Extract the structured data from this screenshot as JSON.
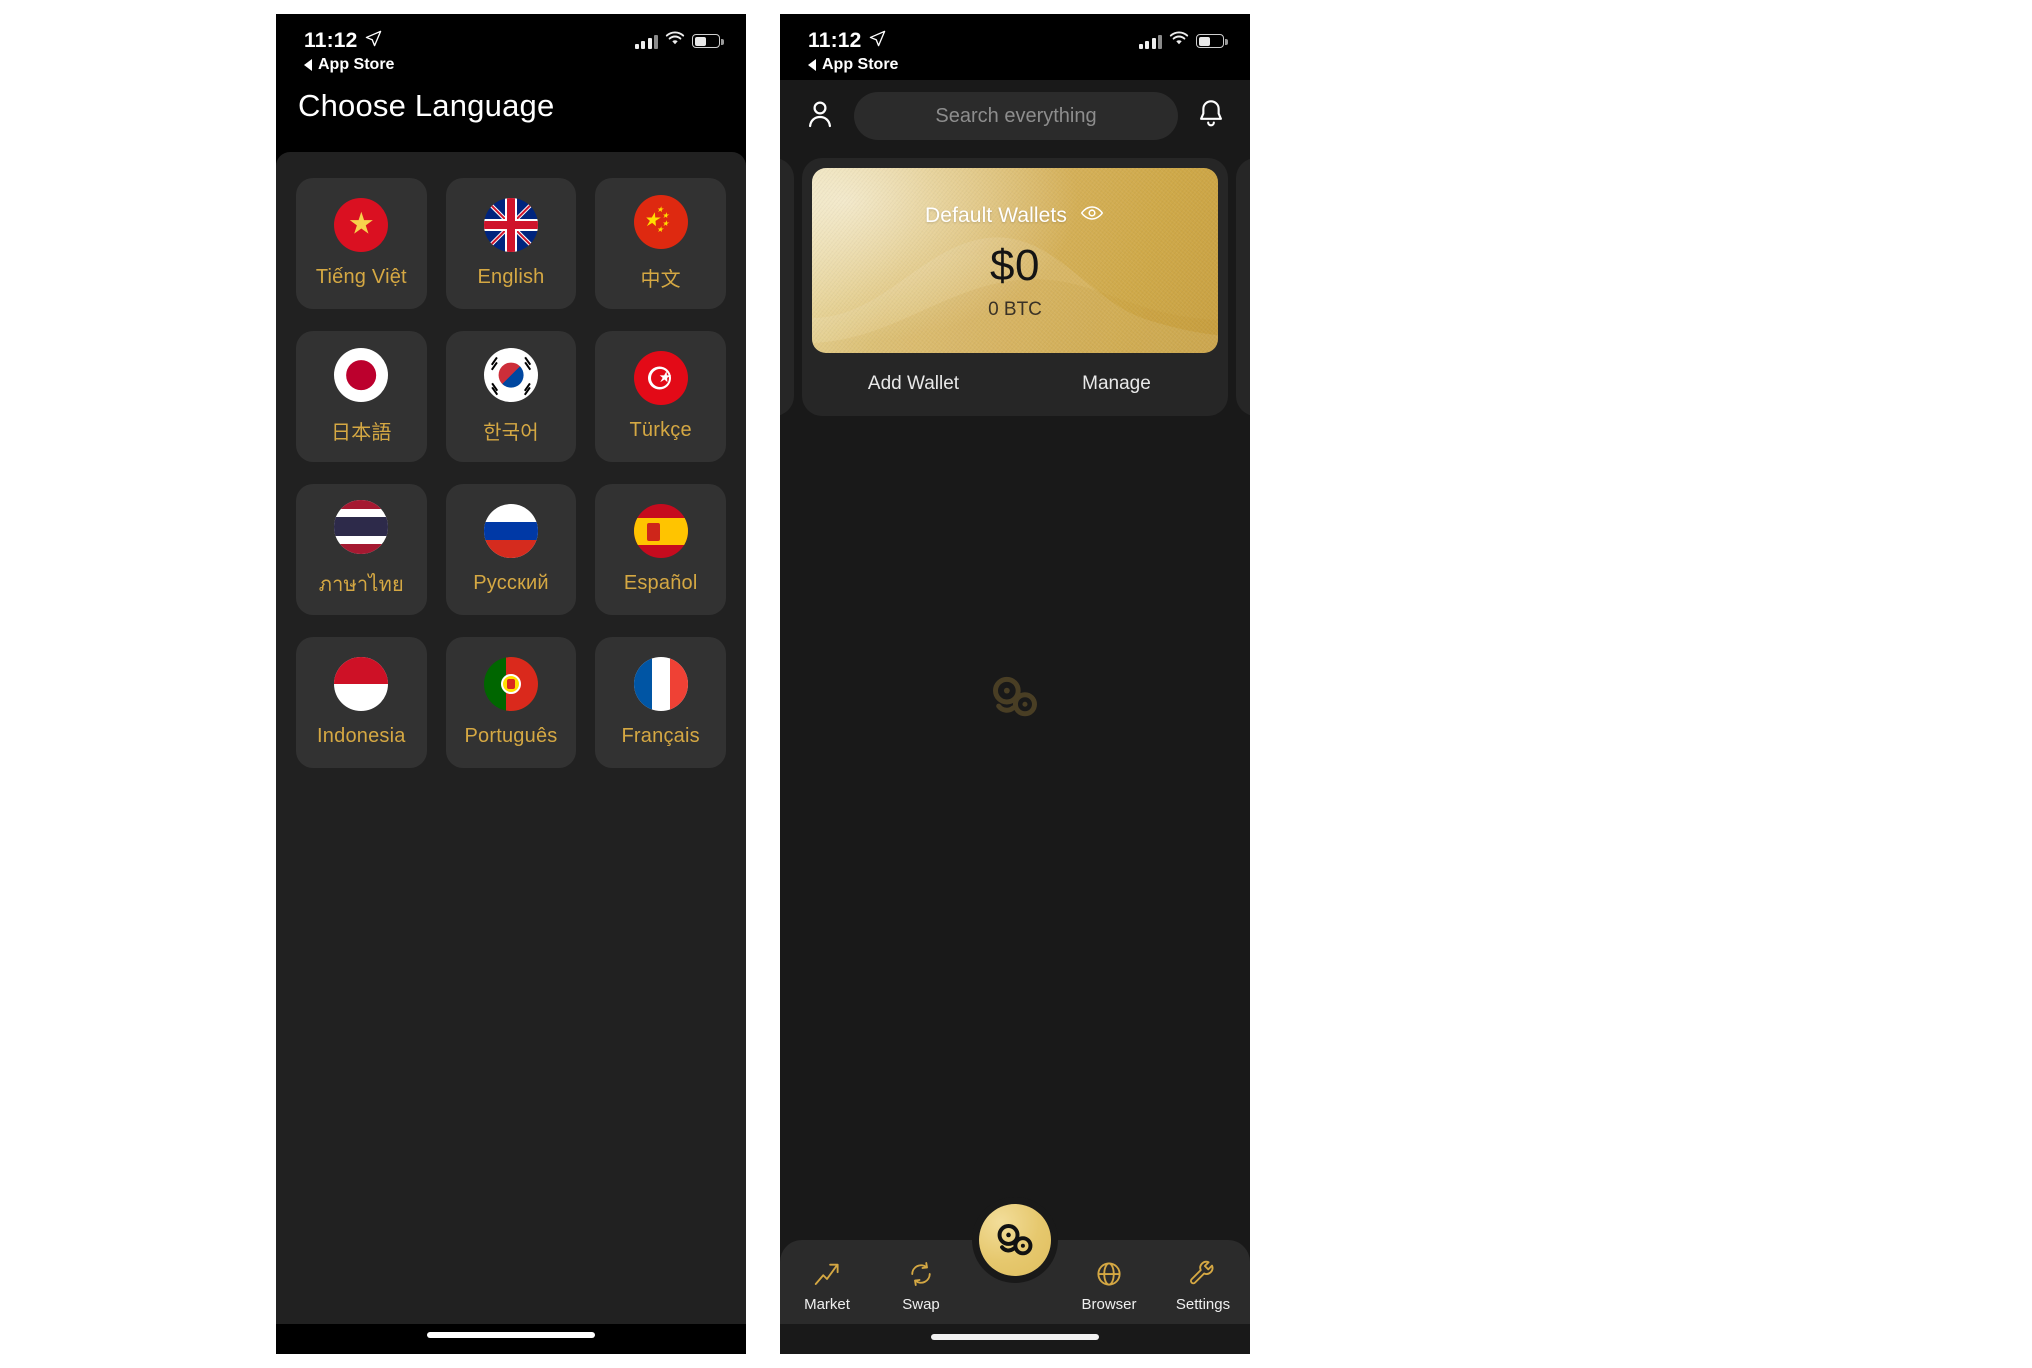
{
  "left_phone": {
    "status": {
      "time": "11:12",
      "location_icon": "location-arrow-icon"
    },
    "back_label": "App Store",
    "nav_title": "Choose Language",
    "languages": [
      {
        "label": "Tiếng Việt",
        "flag": "vn"
      },
      {
        "label": "English",
        "flag": "gb"
      },
      {
        "label": "中文",
        "flag": "cn"
      },
      {
        "label": "日本語",
        "flag": "jp"
      },
      {
        "label": "한국어",
        "flag": "kr"
      },
      {
        "label": "Türkçe",
        "flag": "tr"
      },
      {
        "label": "ภาษาไทย",
        "flag": "th"
      },
      {
        "label": "Русский",
        "flag": "ru"
      },
      {
        "label": "Español",
        "flag": "es"
      },
      {
        "label": "Indonesia",
        "flag": "id"
      },
      {
        "label": "Português",
        "flag": "pt"
      },
      {
        "label": "Français",
        "flag": "fr"
      }
    ]
  },
  "right_phone": {
    "status": {
      "time": "11:12",
      "location_icon": "location-arrow-icon"
    },
    "back_label": "App Store",
    "header": {
      "profile_icon": "person-icon",
      "notification_icon": "bell-icon",
      "search_placeholder": "Search everything"
    },
    "wallet_card": {
      "title": "Default Wallets",
      "visibility_icon": "eye-icon",
      "amount": "$0",
      "sub_amount": "0 BTC",
      "add_label": "Add Wallet",
      "manage_label": "Manage"
    },
    "tabs": [
      {
        "label": "Market",
        "icon": "market-icon"
      },
      {
        "label": "Swap",
        "icon": "swap-icon"
      },
      {
        "label": "Browser",
        "icon": "globe-icon"
      },
      {
        "label": "Settings",
        "icon": "wrench-icon"
      }
    ],
    "fab_icon": "app-logo-icon",
    "watermark_icon": "app-logo-icon"
  },
  "colors": {
    "gold_text": "#d5a843",
    "card_bg": "#323232",
    "page_bg": "#212121",
    "gold_card": "#d6b25c"
  }
}
